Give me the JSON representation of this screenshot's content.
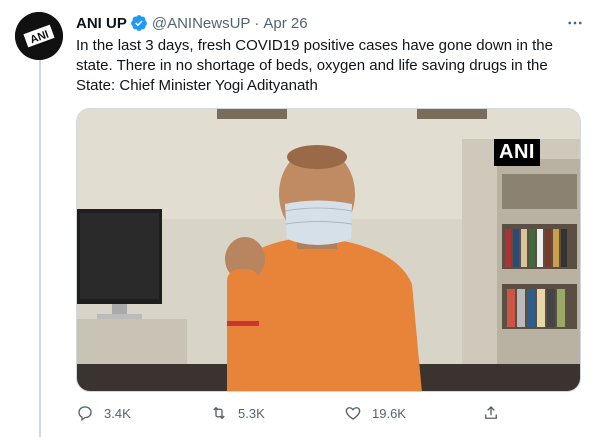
{
  "author": {
    "name": "ANI UP",
    "handle": "@ANINewsUP",
    "separator": "·",
    "date": "Apr 26",
    "avatar_text": "ANI"
  },
  "tweet": {
    "text": "In the last 3 days, fresh COVID19 positive cases have gone down in the state. There in no shortage of beds, oxygen and life saving drugs in the State: Chief Minister Yogi Adityanath"
  },
  "media": {
    "watermark": "ANI"
  },
  "actions": {
    "replies": "3.4K",
    "retweets": "5.3K",
    "likes": "19.6K"
  },
  "colors": {
    "verified": "#1d9bf0",
    "secondary_text": "#536471",
    "border": "#cfd9de"
  },
  "icons": {
    "reply": "reply-icon",
    "retweet": "retweet-icon",
    "like": "heart-icon",
    "share": "share-icon",
    "more": "more-icon",
    "verified": "verified-badge-icon"
  }
}
